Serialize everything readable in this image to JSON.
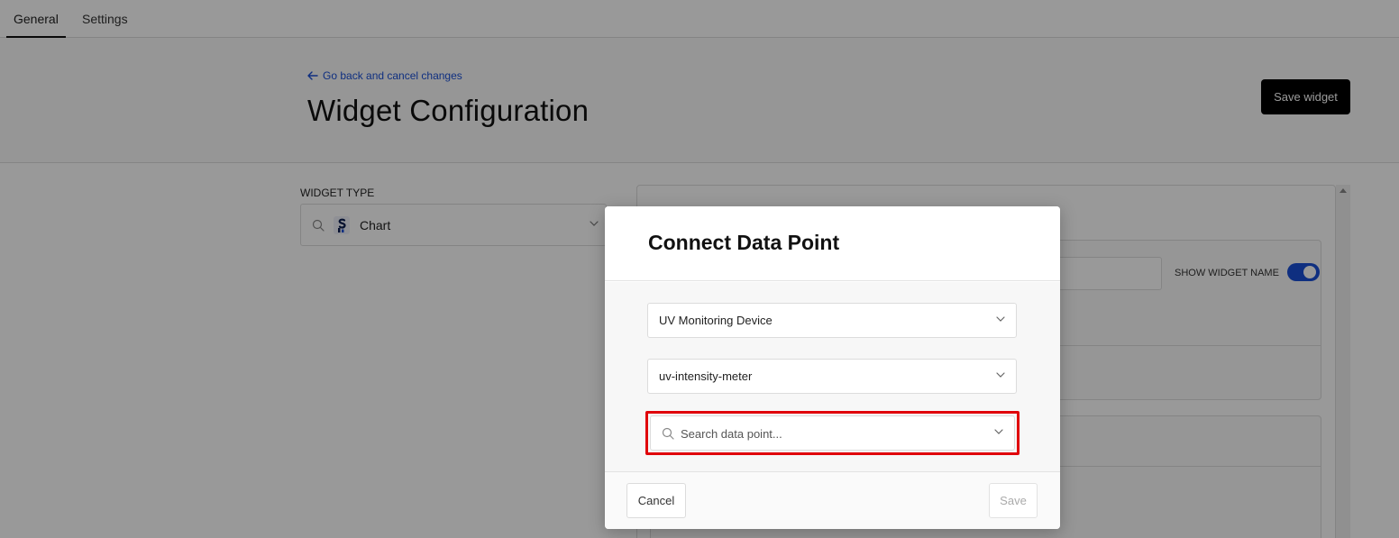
{
  "tabs": [
    {
      "label": "General",
      "active": true
    },
    {
      "label": "Settings",
      "active": false
    }
  ],
  "header": {
    "back_link": "Go back and cancel changes",
    "title": "Widget Configuration",
    "save_button": "Save widget"
  },
  "widget_type": {
    "label": "WIDGET TYPE",
    "value": "Chart"
  },
  "panel": {
    "show_widget_name_label": "SHOW WIDGET NAME",
    "show_widget_name_on": true
  },
  "modal": {
    "title": "Connect Data Point",
    "device_select": "UV Monitoring Device",
    "sensor_select": "uv-intensity-meter",
    "search_placeholder": "Search data point...",
    "cancel_button": "Cancel",
    "save_button": "Save"
  },
  "colors": {
    "accent": "#1a4fd6",
    "highlight": "#e0000a",
    "primary_button": "#000000"
  }
}
